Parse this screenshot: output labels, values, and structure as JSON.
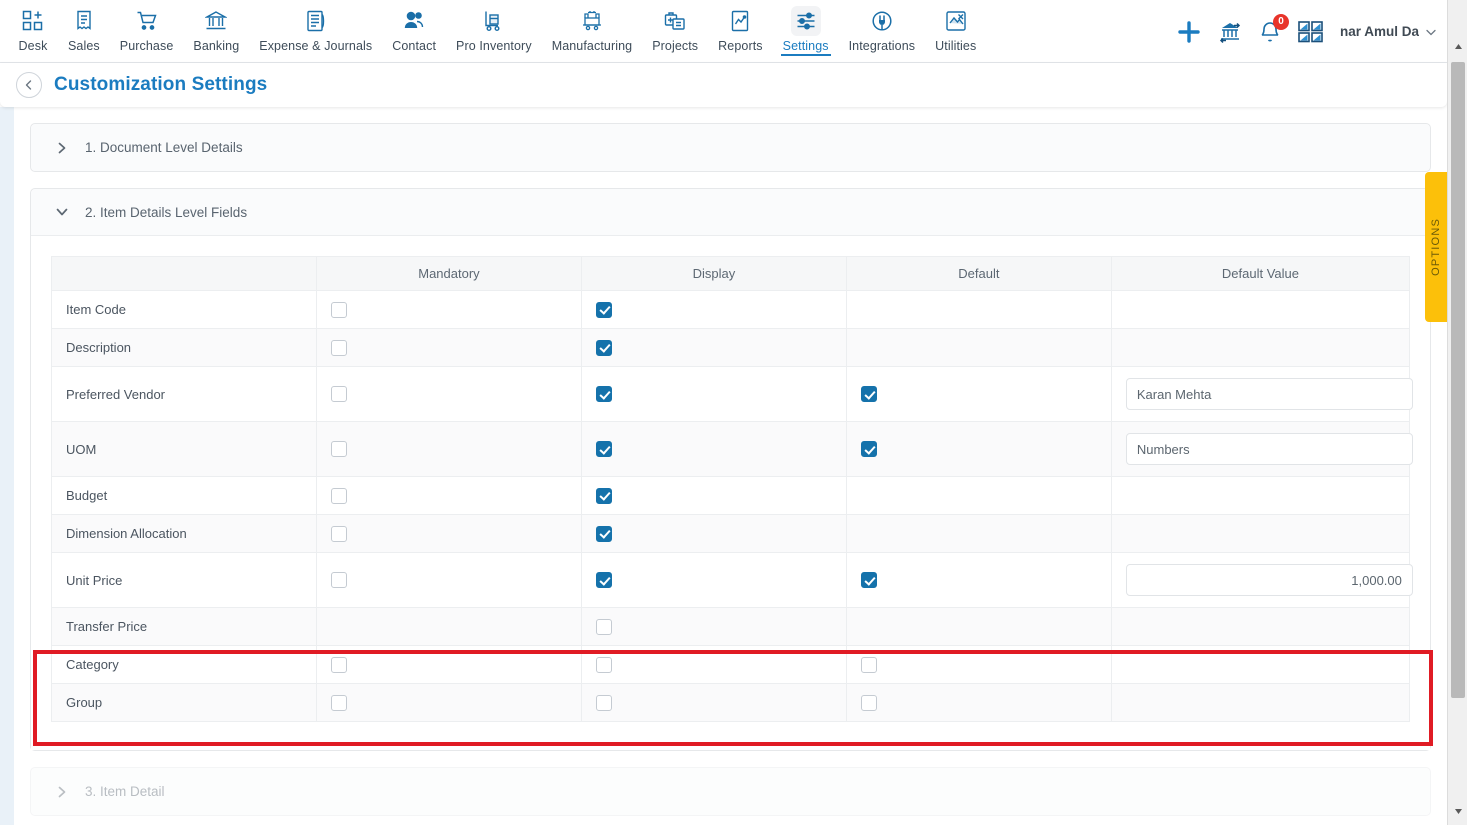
{
  "topnav": {
    "items": [
      {
        "label": "Desk",
        "icon": "desk-icon",
        "active": false
      },
      {
        "label": "Sales",
        "icon": "sales-icon",
        "active": false
      },
      {
        "label": "Purchase",
        "icon": "purchase-icon",
        "active": false
      },
      {
        "label": "Banking",
        "icon": "banking-icon",
        "active": false
      },
      {
        "label": "Expense & Journals",
        "icon": "expense-icon",
        "active": false
      },
      {
        "label": "Contact",
        "icon": "contact-icon",
        "active": false
      },
      {
        "label": "Pro Inventory",
        "icon": "inventory-icon",
        "active": false
      },
      {
        "label": "Manufacturing",
        "icon": "manufacturing-icon",
        "active": false
      },
      {
        "label": "Projects",
        "icon": "projects-icon",
        "active": false
      },
      {
        "label": "Reports",
        "icon": "reports-icon",
        "active": false
      },
      {
        "label": "Settings",
        "icon": "settings-icon",
        "active": true
      },
      {
        "label": "Integrations",
        "icon": "integrations-icon",
        "active": false
      },
      {
        "label": "Utilities",
        "icon": "utilities-icon",
        "active": false
      }
    ],
    "right": {
      "add_icon": "plus-icon",
      "bank_transfer_icon": "bank-transfer-icon",
      "bell_icon": "bell-icon",
      "bell_badge": "0",
      "apps_icon": "apps-grid-icon",
      "user_name": "nar Amul Da",
      "user_chevron": "chevron-down-icon"
    }
  },
  "header": {
    "back_icon": "chevron-left-icon",
    "title": "Customization Settings"
  },
  "sections": [
    {
      "chevron": "chevron-right-icon",
      "title": "1. Document Level Details",
      "open": false,
      "faded": false
    },
    {
      "chevron": "chevron-down-icon",
      "title": "2. Item Details Level Fields",
      "open": true,
      "faded": false
    },
    {
      "chevron": "chevron-right-icon",
      "title": "3. Item Detail",
      "open": false,
      "faded": true
    }
  ],
  "table": {
    "columns": [
      "",
      "Mandatory",
      "Display",
      "Default",
      "Default Value"
    ],
    "rows": [
      {
        "label": "Item Code",
        "mandatory": false,
        "display": true,
        "default": null,
        "value": null,
        "value_align": "left",
        "tall": false,
        "highlighted": false
      },
      {
        "label": "Description",
        "mandatory": false,
        "display": true,
        "default": null,
        "value": null,
        "value_align": "left",
        "tall": false,
        "highlighted": false
      },
      {
        "label": "Preferred Vendor",
        "mandatory": false,
        "display": true,
        "default": true,
        "value": "Karan Mehta",
        "value_align": "left",
        "tall": true,
        "highlighted": false
      },
      {
        "label": "UOM",
        "mandatory": false,
        "display": true,
        "default": true,
        "value": "Numbers",
        "value_align": "left",
        "tall": true,
        "highlighted": false
      },
      {
        "label": "Budget",
        "mandatory": false,
        "display": true,
        "default": null,
        "value": null,
        "value_align": "left",
        "tall": false,
        "highlighted": false
      },
      {
        "label": "Dimension Allocation",
        "mandatory": false,
        "display": true,
        "default": null,
        "value": null,
        "value_align": "left",
        "tall": false,
        "highlighted": false
      },
      {
        "label": "Unit Price",
        "mandatory": false,
        "display": true,
        "default": true,
        "value": "1,000.00",
        "value_align": "right",
        "tall": true,
        "highlighted": false
      },
      {
        "label": "Transfer Price",
        "mandatory": null,
        "display": false,
        "default": null,
        "value": null,
        "value_align": "left",
        "tall": false,
        "highlighted": false
      },
      {
        "label": "Category",
        "mandatory": false,
        "display": false,
        "default": false,
        "value": null,
        "value_align": "left",
        "tall": false,
        "highlighted": true
      },
      {
        "label": "Group",
        "mandatory": false,
        "display": false,
        "default": false,
        "value": null,
        "value_align": "left",
        "tall": false,
        "highlighted": true
      }
    ]
  },
  "options_tab": {
    "label": "OPTIONS",
    "color": "#fcc00a"
  },
  "colors": {
    "accent_blue": "#1b7cc0",
    "checkbox_blue": "#1572ab",
    "badge_red": "#e8342a",
    "highlight_red": "#e01b24",
    "page_bg": "#e9f1f8"
  }
}
